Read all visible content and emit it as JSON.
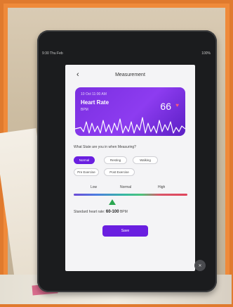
{
  "status_bar": {
    "left": "9:30 Thu Feb",
    "right": "100%"
  },
  "app": {
    "title": "Measurement",
    "back_icon": "chevron-left-icon"
  },
  "card": {
    "timestamp": "10 Oct 11:00 AM",
    "title": "Heart Rate",
    "unit": "BPM",
    "value": "66",
    "heart_icon": "heart-icon",
    "accent_colors": [
      "#7a2fe0",
      "#5b1fc4"
    ]
  },
  "question": "What State are you in when Measuring?",
  "states": [
    {
      "label": "Normal",
      "selected": true
    },
    {
      "label": "Resting",
      "selected": false
    },
    {
      "label": "Walking",
      "selected": false
    },
    {
      "label": "Pre Exercise",
      "selected": false
    },
    {
      "label": "Post Exercise",
      "selected": false
    }
  ],
  "scale": {
    "labels": [
      "Low",
      "Normal",
      "High"
    ],
    "colors": [
      "#6c4bd6",
      "#4ec27a",
      "#e0445c"
    ]
  },
  "normal_range": {
    "prefix": "Standard heart rate:",
    "value": "60-100",
    "unit": "BPM"
  },
  "actions": {
    "save_label": "Save"
  },
  "fab_icon": "close-icon"
}
